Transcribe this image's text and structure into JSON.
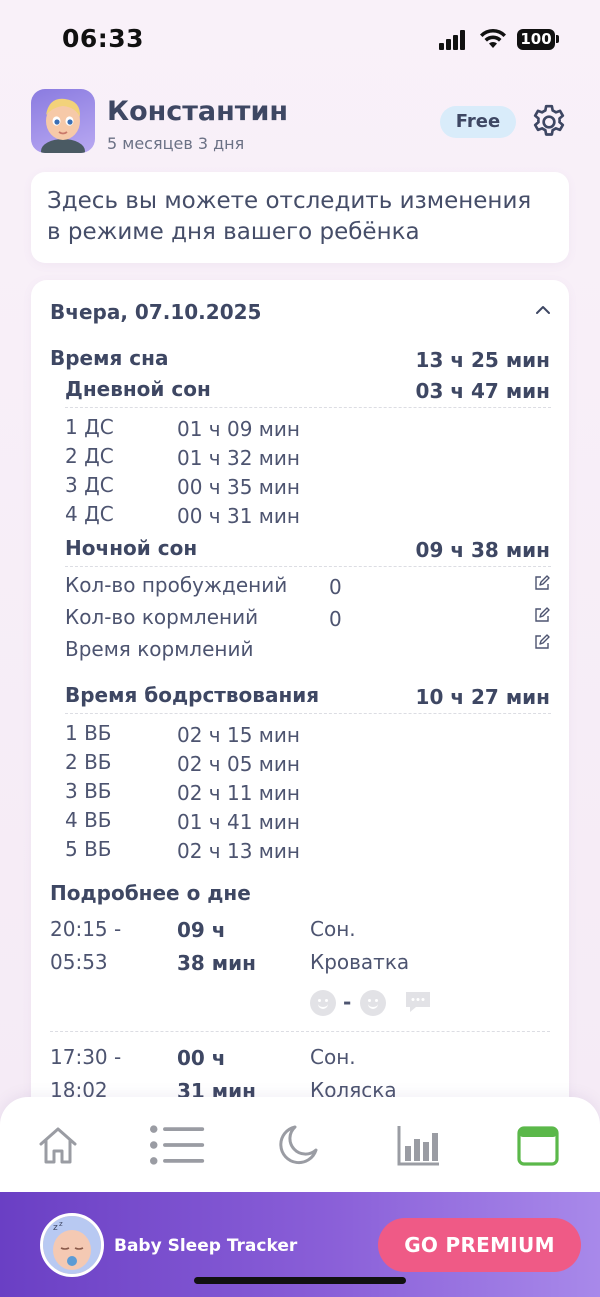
{
  "status_bar": {
    "time": "06:33",
    "battery": "100"
  },
  "profile": {
    "name": "Константин",
    "age": "5 месяцев 3 дня",
    "plan_badge": "Free"
  },
  "info": {
    "text_line1": "Здесь вы можете отследить изменения",
    "text_line2": "в режиме дня вашего ребёнка"
  },
  "day": {
    "date_title": "Вчера, 07.10.2025",
    "sleep_time": {
      "label": "Время сна",
      "value": "13 ч 25 мин"
    },
    "day_sleep": {
      "label": "Дневной сон",
      "value": "03 ч 47 мин",
      "items": [
        {
          "name": "1 ДС",
          "duration": "01 ч 09 мин"
        },
        {
          "name": "2 ДС",
          "duration": "01 ч 32 мин"
        },
        {
          "name": "3 ДС",
          "duration": "00 ч 35 мин"
        },
        {
          "name": "4 ДС",
          "duration": "00 ч 31 мин"
        }
      ]
    },
    "night_sleep": {
      "label": "Ночной сон",
      "value": "09 ч 38 мин",
      "wakeups_label": "Кол-во пробуждений",
      "wakeups_value": "0",
      "feedings_label": "Кол-во кормлений",
      "feedings_value": "0",
      "feeding_time_label": "Время кормлений"
    },
    "wake_time": {
      "label": "Время бодрствования",
      "value": "10 ч 27 мин",
      "items": [
        {
          "name": "1 ВБ",
          "duration": "02 ч 15 мин"
        },
        {
          "name": "2 ВБ",
          "duration": "02 ч 05 мин"
        },
        {
          "name": "3 ВБ",
          "duration": "02 ч 11 мин"
        },
        {
          "name": "4 ВБ",
          "duration": "01 ч 41 мин"
        },
        {
          "name": "5 ВБ",
          "duration": "02 ч 13 мин"
        }
      ]
    },
    "details": {
      "title": "Подробнее о дне",
      "entries": [
        {
          "start": "20:15 -",
          "end": "05:53",
          "dur_h": "09 ч",
          "dur_m": "38 мин",
          "type": "Сон.",
          "place": "Кроватка",
          "mood_separator": "-"
        },
        {
          "start": "17:30 -",
          "end": "18:02",
          "dur_h": "00 ч",
          "dur_m": "31 мин",
          "type": "Сон.",
          "place": "Коляска"
        }
      ]
    }
  },
  "nav": {
    "items": [
      "home-icon",
      "list-icon",
      "moon-icon",
      "stats-icon",
      "calendar-icon"
    ],
    "active": "calendar-icon",
    "active_color": "#5bb84a",
    "inactive_color": "#9a9ca3"
  },
  "premium": {
    "app_name": "Baby Sleep Tracker",
    "button_label": "GO PREMIUM"
  }
}
